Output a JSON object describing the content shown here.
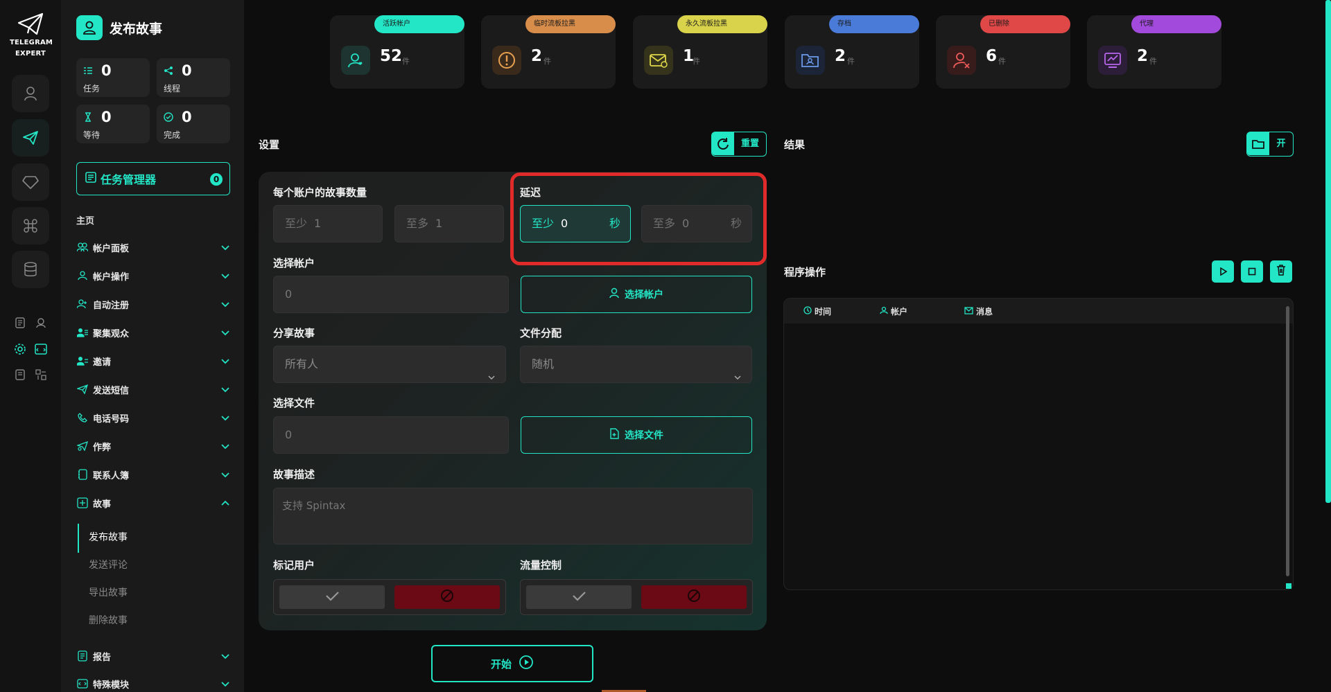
{
  "brand": {
    "logo_line1": "TELEGRAM",
    "logo_line2": "EXPERT"
  },
  "sidebar": {
    "title": "发布故事",
    "stats": [
      {
        "value": "0",
        "label": "任务"
      },
      {
        "value": "0",
        "label": "线程"
      },
      {
        "value": "0",
        "label": "等待"
      },
      {
        "value": "0",
        "label": "完成"
      }
    ],
    "task_manager": {
      "label": "任务管理器",
      "count": "0"
    },
    "section_title": "主页",
    "items": [
      {
        "label": "帐户面板"
      },
      {
        "label": "帐户操作"
      },
      {
        "label": "自动注册"
      },
      {
        "label": "聚集观众"
      },
      {
        "label": "邀请"
      },
      {
        "label": "发送短信"
      },
      {
        "label": "电话号码"
      },
      {
        "label": "作弊"
      },
      {
        "label": "联系人簿"
      },
      {
        "label": "故事"
      },
      {
        "label": "报告"
      },
      {
        "label": "特殊模块"
      }
    ],
    "story_sub": [
      {
        "label": "发布故事"
      },
      {
        "label": "发送评论"
      },
      {
        "label": "导出故事"
      },
      {
        "label": "删除故事"
      }
    ]
  },
  "cards": [
    {
      "tag": "活跃帐户",
      "value": "52",
      "unit": "件",
      "color": "#23e6c6"
    },
    {
      "tag": "临时流板拉黑",
      "value": "2",
      "unit": "件",
      "color": "#d98d4a"
    },
    {
      "tag": "永久流板拉黑",
      "value": "1",
      "unit": "件",
      "color": "#d8d34a"
    },
    {
      "tag": "存档",
      "value": "2",
      "unit": "件",
      "color": "#4a7bd9"
    },
    {
      "tag": "已删除",
      "value": "6",
      "unit": "件",
      "color": "#e04848"
    },
    {
      "tag": "代理",
      "value": "2",
      "unit": "件",
      "color": "#a24adb"
    }
  ],
  "settings": {
    "title": "设置",
    "reset_label": "重置",
    "stories_per_account": {
      "label": "每个账户的故事数量",
      "min_prefix": "至少",
      "min_value": "1",
      "max_prefix": "至多",
      "max_value": "1"
    },
    "delay": {
      "label": "延迟",
      "min_prefix": "至少",
      "min_value": "0",
      "min_suffix": "秒",
      "max_prefix": "至多",
      "max_value": "0",
      "max_suffix": "秒"
    },
    "select_account": {
      "label": "选择帐户",
      "value": "0",
      "button": "选择帐户"
    },
    "share_story": {
      "label": "分享故事",
      "value": "所有人"
    },
    "file_distribution": {
      "label": "文件分配",
      "value": "随机"
    },
    "select_file": {
      "label": "选择文件",
      "value": "0",
      "button": "选择文件"
    },
    "story_description": {
      "label": "故事描述",
      "placeholder": "支持 Spintax"
    },
    "mark_users": {
      "label": "标记用户"
    },
    "flow_control": {
      "label": "流量控制"
    },
    "start_label": "开始"
  },
  "results": {
    "title": "结果",
    "open_label": "开",
    "program_ops": "程序操作",
    "columns": [
      "时间",
      "帐户",
      "消息"
    ]
  },
  "colors": {
    "accent": "#23e6c6",
    "highlight": "#e12b2b",
    "deny": "#6b0a14"
  }
}
